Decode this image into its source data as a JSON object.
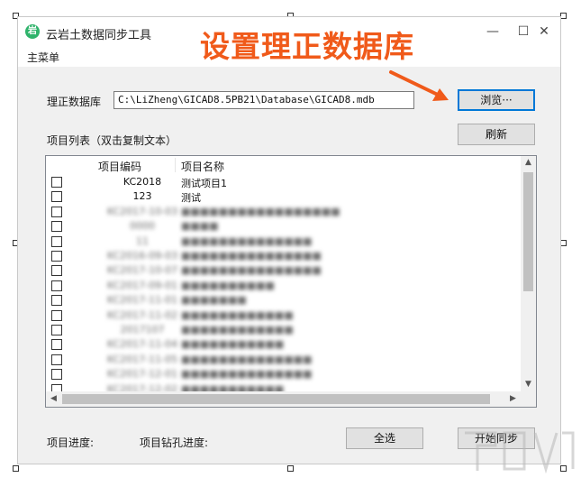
{
  "window": {
    "title": "云岩土数据同步工具",
    "icon_glyph": "岩",
    "minimize_glyph": "—",
    "maximize_glyph": "☐",
    "close_glyph": "✕"
  },
  "menu": {
    "main": "主菜单"
  },
  "annotation": {
    "text": "设置理正数据库",
    "color": "#f05a1a"
  },
  "db": {
    "label": "理正数据库",
    "path": "C:\\LiZheng\\GICAD8.5PB21\\Database\\GICAD8.mdb",
    "browse": "浏览···"
  },
  "project_list": {
    "label": "项目列表（双击复制文本）",
    "refresh": "刷新",
    "columns": {
      "code": "项目编码",
      "name": "项目名称"
    },
    "rows": [
      {
        "code": "KC2018",
        "name": "测试项目1"
      },
      {
        "code": "123",
        "name": "测试"
      },
      {
        "code": "KC2017-10-03",
        "name": "■■■■■■■■■■■■■■■■■"
      },
      {
        "code": "0000",
        "name": "■■■■"
      },
      {
        "code": "11",
        "name": "■■■■■■■■■■■■■■"
      },
      {
        "code": "KC2016-09-03",
        "name": "■■■■■■■■■■■■■■■"
      },
      {
        "code": "KC2017-10-07",
        "name": "■■■■■■■■■■■■■■■"
      },
      {
        "code": "KC2017-09-01",
        "name": "■■■■■■■■■■"
      },
      {
        "code": "KC2017-11-01",
        "name": "■■■■■■■"
      },
      {
        "code": "KC2017-11-02",
        "name": "■■■■■■■■■■■■"
      },
      {
        "code": "2017107",
        "name": "■■■■■■■■■■■■"
      },
      {
        "code": "KC2017-11-04",
        "name": "■■■■■■■■■■■"
      },
      {
        "code": "KC2017-11-05",
        "name": "■■■■■■■■■■■■■■"
      },
      {
        "code": "KC2017-12-01",
        "name": "■■■■■■■■■■■■■■"
      },
      {
        "code": "KC2017-12-02",
        "name": "■■■■■■■■■■■"
      }
    ]
  },
  "footer": {
    "progress_label": "项目进度:",
    "drill_progress_label": "项目钻孔进度:",
    "select_all": "全选",
    "start_sync": "开始同步"
  },
  "icons": {
    "scroll_up": "▲",
    "scroll_down": "▼",
    "scroll_left": "◀",
    "scroll_right": "▶"
  }
}
